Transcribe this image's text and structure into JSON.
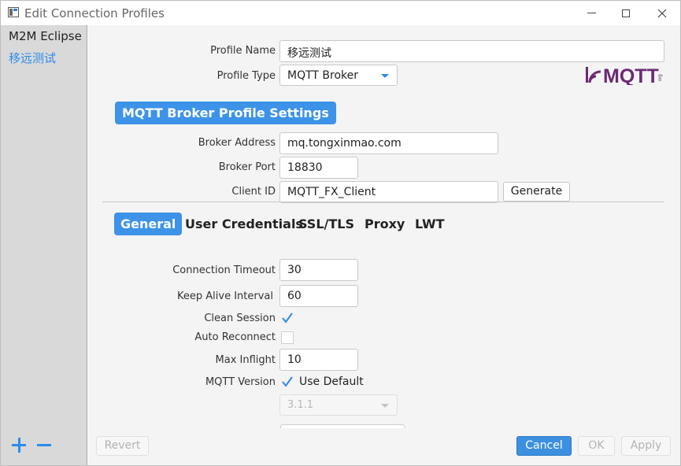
{
  "window": {
    "title": "Edit Connection Profiles"
  },
  "sidebar": {
    "items": [
      {
        "label": "M2M Eclipse"
      },
      {
        "label": "移远测试"
      }
    ]
  },
  "profile": {
    "name_label": "Profile Name",
    "name_value": "移远测试",
    "type_label": "Profile Type",
    "type_value": "MQTT Broker",
    "logo_text": "MQTT",
    "logo_small": "org"
  },
  "section_title": "MQTT Broker Profile Settings",
  "broker": {
    "address_label": "Broker Address",
    "address_value": "mq.tongxinmao.com",
    "port_label": "Broker Port",
    "port_value": "18830",
    "client_id_label": "Client ID",
    "client_id_value": "MQTT_FX_Client",
    "generate_label": "Generate"
  },
  "tabs": [
    {
      "label": "General",
      "active": true
    },
    {
      "label": "User Credentials"
    },
    {
      "label": "SSL/TLS"
    },
    {
      "label": "Proxy"
    },
    {
      "label": "LWT"
    }
  ],
  "general": {
    "connection_timeout_label": "Connection Timeout",
    "connection_timeout_value": "30",
    "keep_alive_label": "Keep Alive Interval",
    "keep_alive_value": "60",
    "clean_session_label": "Clean Session",
    "clean_session_checked": true,
    "auto_reconnect_label": "Auto Reconnect",
    "auto_reconnect_checked": false,
    "max_inflight_label": "Max Inflight",
    "max_inflight_value": "10",
    "mqtt_version_label": "MQTT Version",
    "use_default_label": "Use Default",
    "use_default_checked": true,
    "version_value": "3.1.1"
  },
  "footer": {
    "revert_label": "Revert",
    "cancel_label": "Cancel",
    "ok_label": "OK",
    "apply_label": "Apply"
  },
  "colors": {
    "accent": "#3d93e8",
    "sidebar_bg": "#d9d9d9",
    "content_bg": "#f4f4f4",
    "logo_purple": "#6b2a73"
  }
}
